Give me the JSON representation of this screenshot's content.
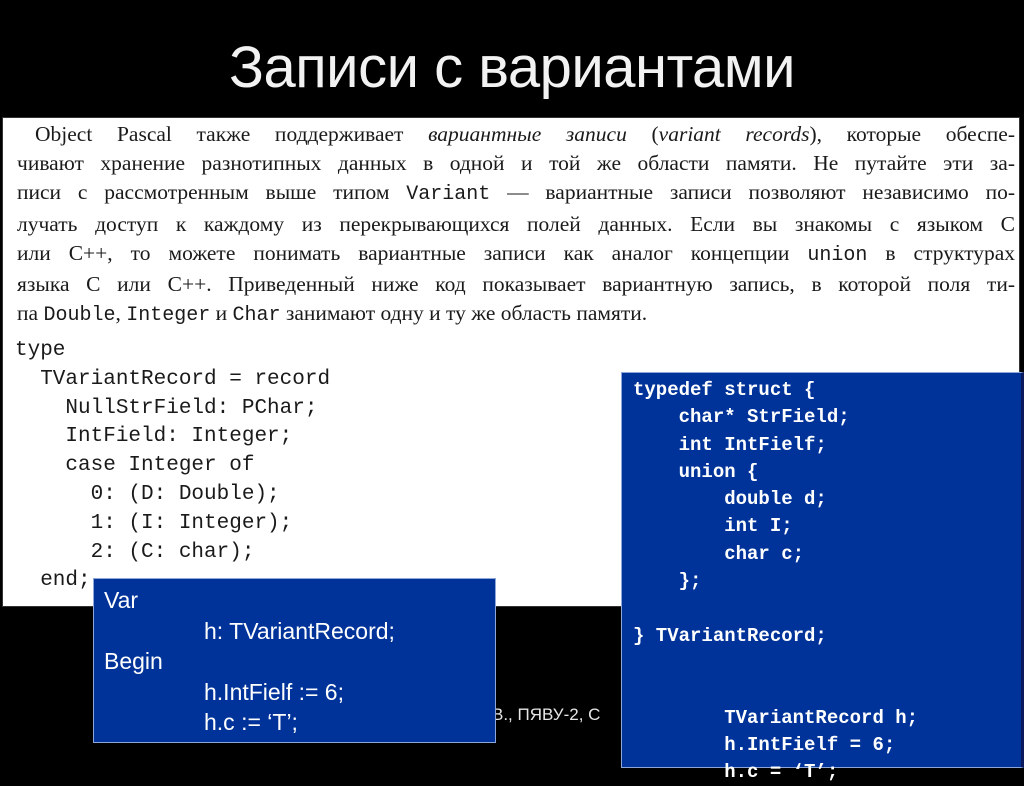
{
  "slide": {
    "title": "Записи с вариантами",
    "footer_partial": "В., ПЯВУ-2, С"
  },
  "book_text": {
    "lines": [
      {
        "parts": [
          {
            "t": "Object Pascal также поддерживает ",
            "s": "normal"
          },
          {
            "t": "вариантные записи",
            "s": "italic"
          },
          {
            "t": " (",
            "s": "normal"
          },
          {
            "t": "variant records",
            "s": "italic"
          },
          {
            "t": "), которые обеспе-",
            "s": "normal"
          }
        ]
      },
      {
        "parts": [
          {
            "t": "чивают хранение разнотипных данных в одной и той же области памяти. Не путайте эти за-",
            "s": "normal"
          }
        ]
      },
      {
        "parts": [
          {
            "t": "писи с рассмотренным выше типом ",
            "s": "normal"
          },
          {
            "t": "Variant",
            "s": "code"
          },
          {
            "t": " — вариантные записи позволяют независимо по-",
            "s": "normal"
          }
        ]
      },
      {
        "parts": [
          {
            "t": "лучать доступ к каждому из перекрывающихся полей данных. Если вы знакомы с языком C",
            "s": "normal"
          }
        ]
      },
      {
        "parts": [
          {
            "t": "или C++, то можете понимать вариантные записи как аналог концепции ",
            "s": "normal"
          },
          {
            "t": "union",
            "s": "code"
          },
          {
            "t": " в структурах",
            "s": "normal"
          }
        ]
      },
      {
        "parts": [
          {
            "t": "языка C или C++. Приведенный ниже код показывает вариантную запись, в которой поля ти-",
            "s": "normal"
          }
        ]
      },
      {
        "parts": [
          {
            "t": "па ",
            "s": "normal"
          },
          {
            "t": "Double",
            "s": "code"
          },
          {
            "t": ", ",
            "s": "normal"
          },
          {
            "t": "Integer",
            "s": "code"
          },
          {
            "t": " и ",
            "s": "normal"
          },
          {
            "t": "Char",
            "s": "code"
          },
          {
            "t": " занимают одну и ту же область памяти.",
            "s": "normal"
          }
        ]
      }
    ]
  },
  "pascal_code": {
    "lines": [
      "type",
      "  TVariantRecord = record",
      "    NullStrField: PChar;",
      "    IntField: Integer;",
      "    case Integer of",
      "      0: (D: Double);",
      "      1: (I: Integer);",
      "      2: (C: char);",
      "  end;"
    ]
  },
  "var_box": {
    "lines": [
      {
        "text": "Var",
        "indent": false
      },
      {
        "text": "h: TVariantRecord;",
        "indent": true
      },
      {
        "text": "Begin",
        "indent": false
      },
      {
        "text": "h.IntFielf := 6;",
        "indent": true
      },
      {
        "text": "h.c := ‘T’;",
        "indent": true
      }
    ]
  },
  "c_box": {
    "lines": [
      "typedef struct {",
      "    char* StrField;",
      "    int IntFielf;",
      "    union {",
      "        double d;",
      "        int I;",
      "        char c;",
      "    };",
      "",
      "} TVariantRecord;",
      "",
      "",
      "        TVariantRecord h;",
      "        h.IntFielf = 6;",
      "        h.c = ‘T’;"
    ]
  },
  "colors": {
    "background": "#000000",
    "box_blue": "#003399",
    "title_text": "#f2f2f2",
    "panel": "#ffffff"
  }
}
